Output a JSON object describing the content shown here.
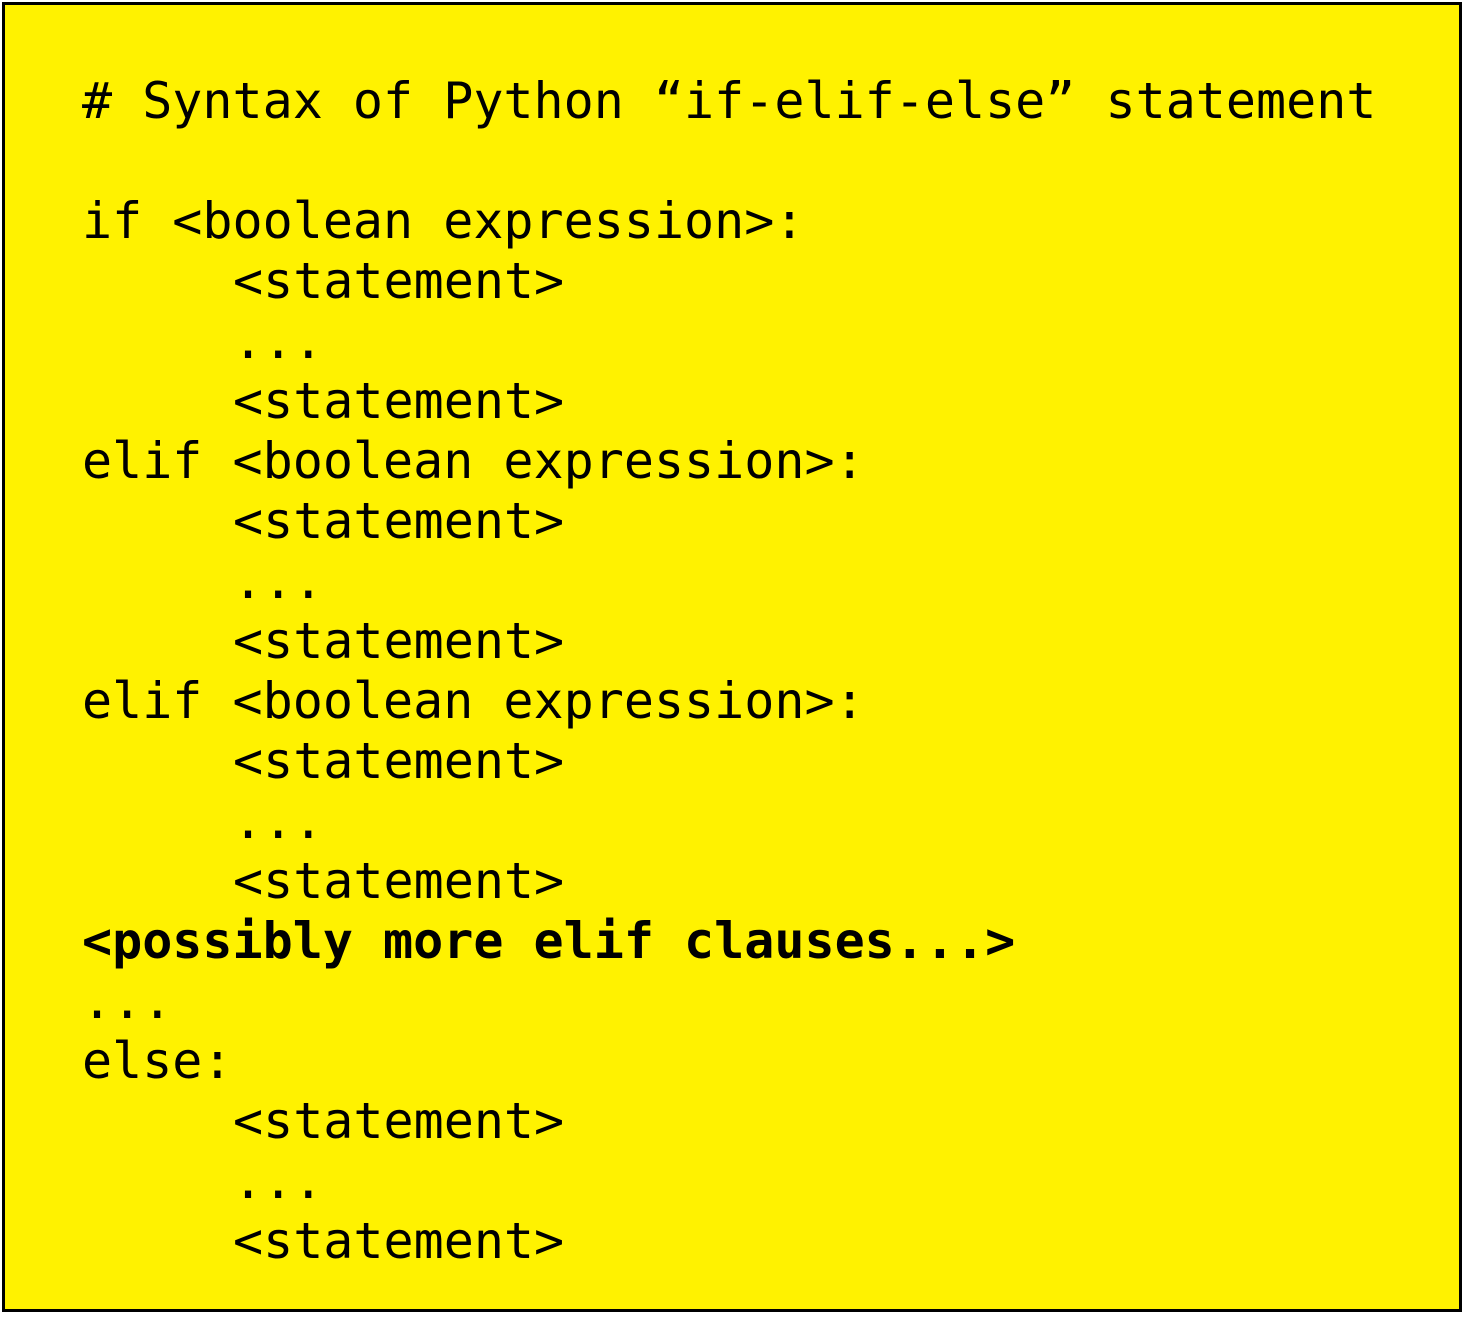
{
  "code_block": {
    "lines": [
      {
        "text": "# Syntax of Python “if-elif-else” statement"
      },
      {
        "text": ""
      },
      {
        "text": "if <boolean expression>:"
      },
      {
        "text": "<statement>"
      },
      {
        "text": "..."
      },
      {
        "text": "<statement>"
      },
      {
        "text": "elif <boolean expression>:"
      },
      {
        "text": "<statement>"
      },
      {
        "text": "..."
      },
      {
        "text": "<statement>"
      },
      {
        "text": "elif <boolean expression>:"
      },
      {
        "text": "<statement>"
      },
      {
        "text": "..."
      },
      {
        "text": "<statement>"
      },
      {
        "text": "<possibly more elif clauses...>"
      },
      {
        "text": "..."
      },
      {
        "text": "else:"
      },
      {
        "text": "<statement>"
      },
      {
        "text": "..."
      },
      {
        "text": "<statement>"
      }
    ]
  },
  "colors": {
    "background": "#FFF200",
    "border": "#000000",
    "text": "#000000"
  }
}
